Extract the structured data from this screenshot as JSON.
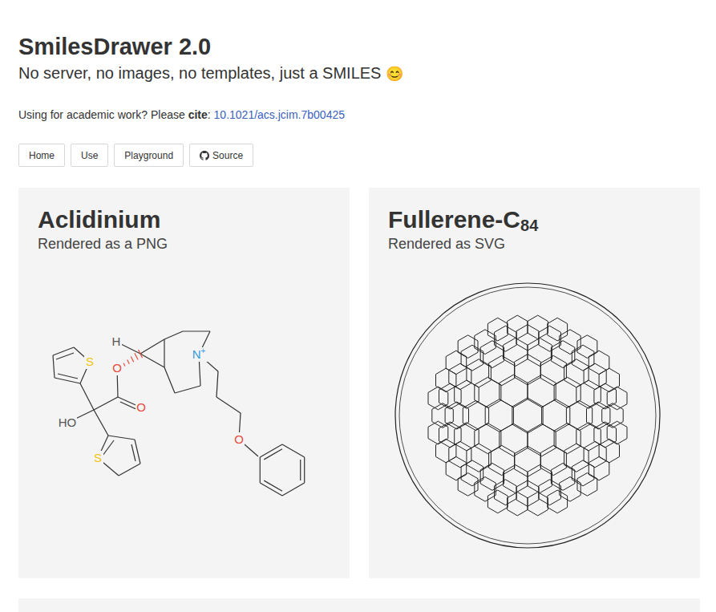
{
  "header": {
    "title": "SmilesDrawer 2.0",
    "tagline": "No server, no images, no templates, just a SMILES",
    "emoji": "😊"
  },
  "citation": {
    "prefix": "Using for academic work? Please ",
    "bold": "cite",
    "colon": ":",
    "doi": "10.1021/acs.jcim.7b00425"
  },
  "nav": [
    {
      "label": "Home",
      "kind": "plain"
    },
    {
      "label": "Use",
      "kind": "plain"
    },
    {
      "label": "Playground",
      "kind": "plain"
    },
    {
      "label": "Source",
      "kind": "github"
    }
  ],
  "cards": [
    {
      "title": "Aclidinium",
      "subtitle": "Rendered as a PNG",
      "kind": "molecule",
      "atoms": [
        {
          "label": "H",
          "color": "#555555"
        },
        {
          "label": "O",
          "color": "#e74c3c"
        },
        {
          "label": "O",
          "color": "#e74c3c"
        },
        {
          "label": "S",
          "color": "#f1c40f"
        },
        {
          "label": "HO",
          "color": "#555555"
        },
        {
          "label": "S",
          "color": "#f1c40f"
        },
        {
          "label": "N",
          "charge": "+",
          "color": "#3498db"
        },
        {
          "label": "O",
          "color": "#e74c3c"
        }
      ]
    },
    {
      "title": "Fullerene-C",
      "subscript": "84",
      "subtitle": "Rendered as SVG",
      "kind": "fullerene",
      "atoms": []
    }
  ]
}
